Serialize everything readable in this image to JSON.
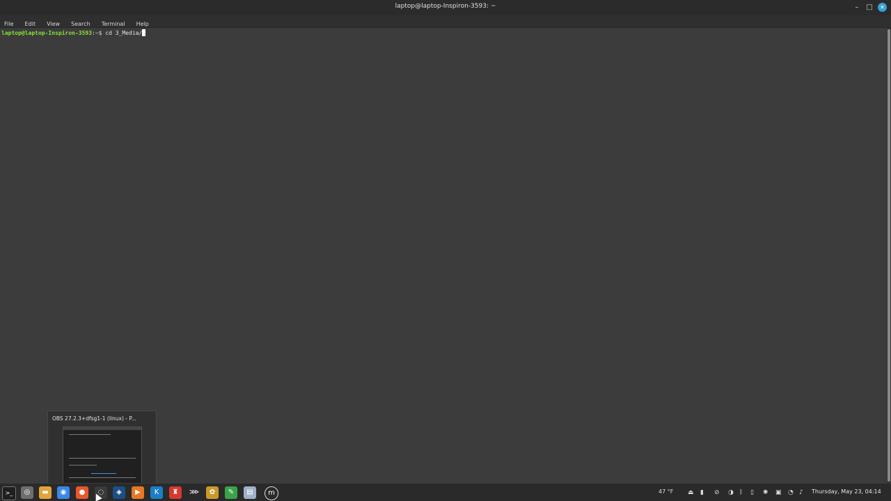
{
  "window": {
    "title": "laptop@laptop-Inspiron-3593: ~",
    "minimize_glyph": "–",
    "maximize_glyph": "□",
    "close_glyph": "✕"
  },
  "menubar": {
    "items": [
      "File",
      "Edit",
      "View",
      "Search",
      "Terminal",
      "Help"
    ]
  },
  "terminal": {
    "prompt_user": "laptop@laptop-Inspiron-3593",
    "prompt_sep": ":~$ ",
    "command": "cd 3_Media/"
  },
  "preview": {
    "title": "OBS 27.2.3+dfsg1-1 (linux) - P..."
  },
  "taskbar": {
    "apps": [
      {
        "name": "terminal-icon",
        "glyph": ">_",
        "color": "#1f1f1f"
      },
      {
        "name": "disk-icon",
        "glyph": "◎",
        "color": "#6e6e6e"
      },
      {
        "name": "folder-icon",
        "glyph": "▬",
        "color": "#e2a43a"
      },
      {
        "name": "chrome-icon",
        "glyph": "◉",
        "color": "#3b87e8"
      },
      {
        "name": "firefox-icon",
        "glyph": "●",
        "color": "#e8572a"
      },
      {
        "name": "obs-icon",
        "glyph": "◌",
        "color": "#3a3a3a"
      },
      {
        "name": "steam-icon",
        "glyph": "◈",
        "color": "#1b4f86"
      },
      {
        "name": "media-player-icon",
        "glyph": "▶",
        "color": "#e87722"
      },
      {
        "name": "kdenlive-icon",
        "glyph": "K",
        "color": "#1a7fc4"
      },
      {
        "name": "music-app-icon",
        "glyph": "♜",
        "color": "#d43a2f"
      },
      {
        "name": "clapper-icon",
        "glyph": "⋙",
        "color": "#2a2a2a"
      },
      {
        "name": "settings-icon",
        "glyph": "✿",
        "color": "#c99a2a"
      },
      {
        "name": "editor-icon",
        "glyph": "✎",
        "color": "#3aa34a"
      },
      {
        "name": "text-editor-icon",
        "glyph": "▤",
        "color": "#9fb1c9"
      },
      {
        "name": "mint-menu-icon",
        "glyph": "m",
        "color": "#2a2a2a"
      }
    ],
    "weather": "47 °F",
    "clock": "Thursday, May 23, 04:14",
    "tray_icons": [
      {
        "name": "upload-icon",
        "glyph": "⏏"
      },
      {
        "name": "clipboard-icon",
        "glyph": "▮"
      },
      {
        "name": "update-icon",
        "glyph": "⊘"
      },
      {
        "name": "steam-tray-icon",
        "glyph": "◑"
      },
      {
        "name": "bluetooth-icon",
        "glyph": "ᛒ"
      },
      {
        "name": "battery-icon",
        "glyph": "▯"
      },
      {
        "name": "network-manager-icon",
        "glyph": "✺"
      },
      {
        "name": "display-icon",
        "glyph": "▣"
      },
      {
        "name": "wifi-icon",
        "glyph": "◔"
      },
      {
        "name": "volume-icon",
        "glyph": "♪"
      },
      {
        "name": "notes-icon",
        "glyph": "✎"
      }
    ]
  }
}
